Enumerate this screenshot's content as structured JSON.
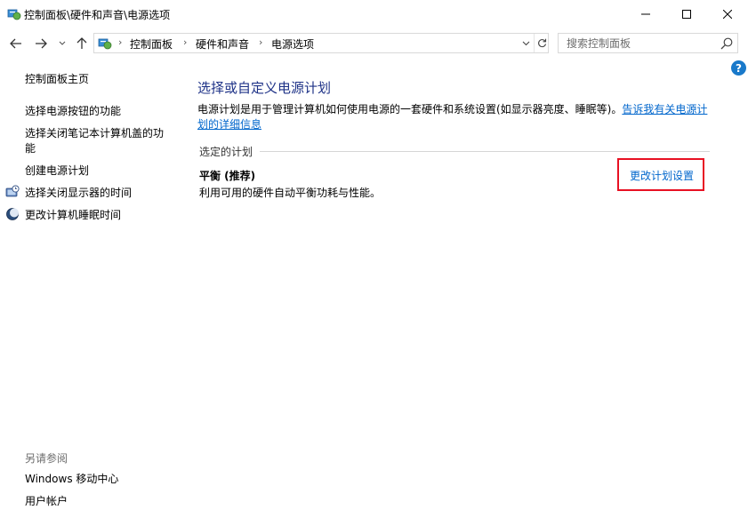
{
  "window": {
    "title": "控制面板\\硬件和声音\\电源选项",
    "minimize_label": "最小化",
    "maximize_label": "最大化",
    "close_label": "关闭"
  },
  "address": {
    "separator": "›",
    "crumbs": [
      "控制面板",
      "硬件和声音",
      "电源选项"
    ]
  },
  "search": {
    "placeholder": "搜索控制面板"
  },
  "sidebar": {
    "home": "控制面板主页",
    "items": [
      {
        "label": "选择电源按钮的功能",
        "icon": null
      },
      {
        "label": "选择关闭笔记本计算机盖的功能",
        "icon": null
      },
      {
        "label": "创建电源计划",
        "icon": null
      },
      {
        "label": "选择关闭显示器的时间",
        "icon": "monitor-clock-icon"
      },
      {
        "label": "更改计算机睡眠时间",
        "icon": "moon-icon"
      }
    ]
  },
  "see_also": {
    "title": "另请参阅",
    "links": [
      "Windows 移动中心",
      "用户帐户"
    ]
  },
  "main": {
    "title": "选择或自定义电源计划",
    "description": "电源计划是用于管理计算机如何使用电源的一套硬件和系统设置(如显示器亮度、睡眠等)。",
    "description_link": "告诉我有关电源计划的详细信息",
    "section_label": "选定的计划",
    "plan": {
      "name": "平衡 (推荐)",
      "description": "利用可用的硬件自动平衡功耗与性能。",
      "change_link": "更改计划设置"
    }
  },
  "colors": {
    "title_blue": "#1e3287",
    "link_blue": "#0066cc",
    "highlight_red": "#e81123",
    "help_blue": "#1979ca"
  }
}
